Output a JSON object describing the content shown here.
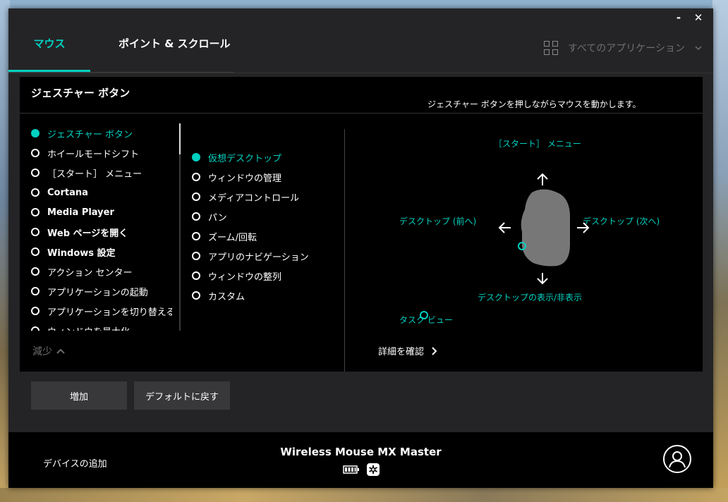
{
  "window": {
    "minimize_glyph": "‐",
    "close_glyph": "✕"
  },
  "tabs": [
    {
      "label": "マウス",
      "active": true
    },
    {
      "label": "ポイント & スクロール",
      "active": false
    }
  ],
  "app_selector": {
    "label": "すべてのアプリケーション",
    "icon": "grid-icon"
  },
  "panel": {
    "title": "ジェスチャー ボタン",
    "instruction": "ジェスチャー ボタンを押しながらマウスを動かします。",
    "functions": [
      {
        "label": "ジェスチャー ボタン",
        "selected": true
      },
      {
        "label": "ホイールモードシフト"
      },
      {
        "label": "［スタート］ メニュー"
      },
      {
        "label": "Cortana"
      },
      {
        "label": "Media Player"
      },
      {
        "label": "Web ページを開く"
      },
      {
        "label": "Windows 設定"
      },
      {
        "label": "アクション センター"
      },
      {
        "label": "アプリケーションの起動"
      },
      {
        "label": "アプリケーションを切り替える"
      },
      {
        "label": "ウィンドウを最大化"
      }
    ],
    "gesture_sets": [
      {
        "label": "仮想デスクトップ",
        "selected": true
      },
      {
        "label": "ウィンドウの管理"
      },
      {
        "label": "メディアコントロール"
      },
      {
        "label": "パン"
      },
      {
        "label": "ズーム/回転"
      },
      {
        "label": "アプリのナビゲーション"
      },
      {
        "label": "ウィンドウの整列"
      },
      {
        "label": "カスタム"
      }
    ],
    "less_label": "減少",
    "diagram": {
      "up": "［スタート］ メニュー",
      "left": "デスクトップ (前へ)",
      "right": "デスクトップ (次へ)",
      "down": "デスクトップの表示/非表示",
      "click": "タスク ビュー"
    },
    "learn_more": "詳細を確認"
  },
  "buttons": {
    "add": "増加",
    "reset": "デフォルトに戻す"
  },
  "footer": {
    "add_device": "デバイスの追加",
    "device_name": "Wireless Mouse MX Master"
  },
  "colors": {
    "accent": "#00d1c1",
    "window_bg": "#242426",
    "panel_bg": "#000000"
  }
}
